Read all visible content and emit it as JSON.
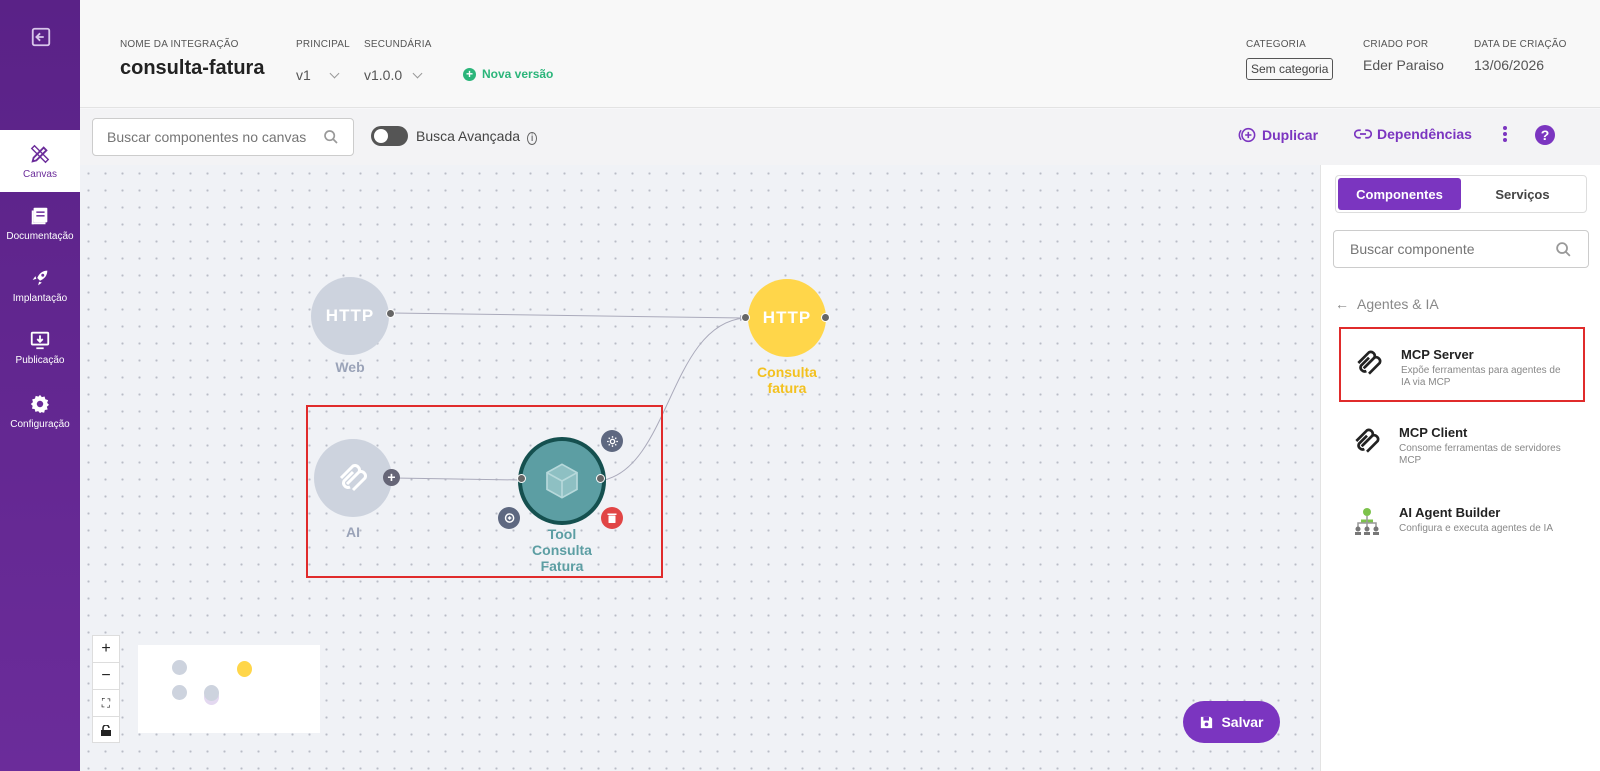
{
  "sidebar": {
    "items": [
      {
        "label": "Canvas",
        "icon": "pencil-ruler-icon"
      },
      {
        "label": "Documentação",
        "icon": "book-icon"
      },
      {
        "label": "Implantação",
        "icon": "rocket-icon"
      },
      {
        "label": "Publicação",
        "icon": "publish-icon"
      },
      {
        "label": "Configuração",
        "icon": "gear-icon"
      }
    ]
  },
  "header": {
    "integration_label": "NOME DA INTEGRAÇÃO",
    "integration_name": "consulta-fatura",
    "principal_label": "PRINCIPAL",
    "principal_value": "v1",
    "secondary_label": "SECUNDÁRIA",
    "secondary_value": "v1.0.0",
    "new_version": "Nova versão",
    "category_label": "CATEGORIA",
    "category_value": "Sem categoria",
    "created_by_label": "CRIADO POR",
    "created_by_value": "Eder Paraiso",
    "created_date_label": "DATA DE CRIAÇÃO",
    "created_date_value": "13/06/2026"
  },
  "toolbar": {
    "search_placeholder": "Buscar componentes no canvas",
    "advanced_search": "Busca Avançada",
    "duplicate": "Duplicar",
    "dependencies": "Dependências"
  },
  "canvas": {
    "nodes": {
      "web_text": "HTTP",
      "web_label": "Web",
      "consulta_text": "HTTP",
      "consulta_label_1": "Consulta",
      "consulta_label_2": "fatura",
      "ai_label": "AI",
      "tool_label_1": "Tool",
      "tool_label_2": "Consulta",
      "tool_label_3": "Fatura"
    },
    "save": "Salvar"
  },
  "panel": {
    "tabs": [
      "Componentes",
      "Serviços"
    ],
    "search_placeholder": "Buscar componente",
    "category": "Agentes & IA",
    "components": [
      {
        "title": "MCP Server",
        "desc": "Expõe ferramentas para agentes de IA via MCP"
      },
      {
        "title": "MCP Client",
        "desc": "Consome ferramentas de servidores MCP"
      },
      {
        "title": "AI Agent Builder",
        "desc": "Configura e executa agentes de IA"
      }
    ]
  },
  "colors": {
    "brand": "#7b35c0",
    "sidebar": "#5a2287",
    "http_yellow": "#ffd64a",
    "node_grey": "#cdd3de",
    "tool_teal": "#5c9ea3",
    "selection": "#e02b2b",
    "success": "#2bb57a"
  }
}
